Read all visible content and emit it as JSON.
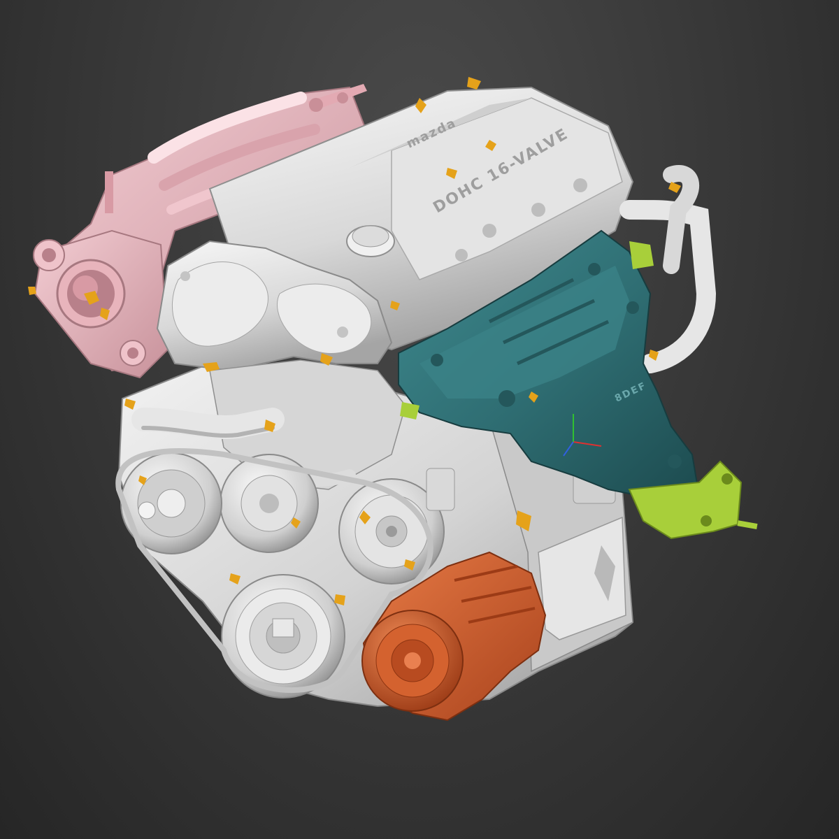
{
  "viewport": {
    "background_top": "#4a4a4a",
    "background_bottom": "#262626"
  },
  "model": {
    "engraving_logo": "mazda",
    "engraving_cover": "DOHC 16-VALVE",
    "engraving_heatshield": "8DEF",
    "colors": {
      "block": "#dcdcdc",
      "block_shade": "#a9a9a9",
      "intake_manifold": "#e8b4bc",
      "exhaust_heatshield": "#2f6e73",
      "exhaust_flange": "#a8cf3a",
      "ac_compressor": "#d4622f",
      "deviation_highlight": "#e5a21a"
    },
    "components": [
      "valve-cover",
      "timing-cover",
      "intake-manifold",
      "throttle-body",
      "exhaust-heatshield",
      "exhaust-flange",
      "ac-compressor",
      "crank-pulley",
      "power-steering-pump",
      "alternator",
      "water-pump",
      "coolant-pipe",
      "oil-filler-cap"
    ]
  },
  "triad": {
    "x_color": "#e03030",
    "y_color": "#30c030",
    "z_color": "#3060e0"
  }
}
